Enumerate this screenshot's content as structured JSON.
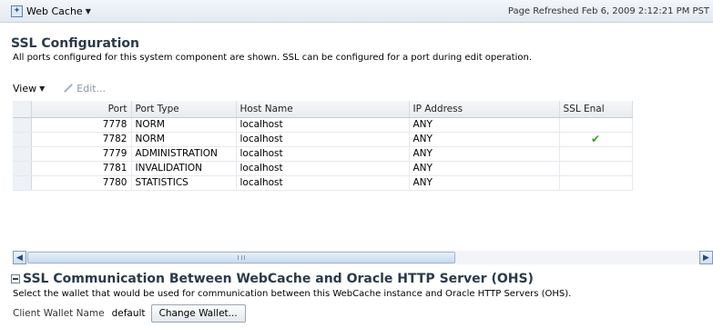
{
  "header": {
    "app_icon": "web-cache-icon",
    "app_title": "Web Cache",
    "refreshed": "Page Refreshed Feb 6, 2009 2:12:21 PM PST"
  },
  "ssl_config": {
    "title": "SSL Configuration",
    "description": "All ports configured for this system component are shown. SSL can be configured for a port during edit operation."
  },
  "toolbar": {
    "view_label": "View",
    "edit_label": "Edit..."
  },
  "table": {
    "columns": [
      "Port",
      "Port Type",
      "Host Name",
      "IP Address",
      "SSL Enal"
    ],
    "rows": [
      {
        "port": "7778",
        "type": "NORM",
        "host": "localhost",
        "ip": "ANY",
        "ssl": ""
      },
      {
        "port": "7782",
        "type": "NORM",
        "host": "localhost",
        "ip": "ANY",
        "ssl": "✔"
      },
      {
        "port": "7779",
        "type": "ADMINISTRATION",
        "host": "localhost",
        "ip": "ANY",
        "ssl": ""
      },
      {
        "port": "7781",
        "type": "INVALIDATION",
        "host": "localhost",
        "ip": "ANY",
        "ssl": ""
      },
      {
        "port": "7780",
        "type": "STATISTICS",
        "host": "localhost",
        "ip": "ANY",
        "ssl": ""
      }
    ]
  },
  "ohs": {
    "title": "SSL Communication Between WebCache and Oracle HTTP Server (OHS)",
    "description": "Select the wallet that would be used for communication between this WebCache instance and Oracle HTTP Servers (OHS).",
    "wallet_label": "Client Wallet Name",
    "wallet_value": "default",
    "change_button": "Change Wallet..."
  },
  "colors": {
    "accent": "#2b3a4a",
    "check": "#3a9a2a"
  }
}
